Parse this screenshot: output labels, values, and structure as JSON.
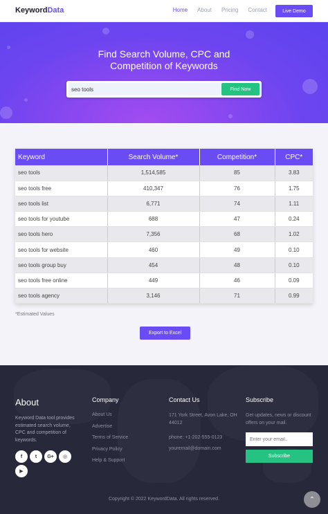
{
  "nav": {
    "logo_main": "Keyword",
    "logo_accent": "Data",
    "links": [
      "Home",
      "About",
      "Pricing",
      "Contact"
    ],
    "demo_label": "Live Demo"
  },
  "hero": {
    "title_line1": "Find Search Volume, CPC and",
    "title_line2": "Competition of Keywords",
    "search_value": "seo tools",
    "find_label": "Find Now"
  },
  "table": {
    "headers": [
      "Keyword",
      "Search Volume*",
      "Competition*",
      "CPC*"
    ],
    "rows": [
      [
        "seo tools",
        "1,514,585",
        "85",
        "3.83"
      ],
      [
        "seo tools free",
        "410,347",
        "76",
        "1.75"
      ],
      [
        "seo tools list",
        "6,771",
        "74",
        "1.11"
      ],
      [
        "seo tools for youtube",
        "688",
        "47",
        "0.24"
      ],
      [
        "seo tools hero",
        "7,356",
        "68",
        "1.02"
      ],
      [
        "seo tools for website",
        "460",
        "49",
        "0.10"
      ],
      [
        "seo tools group buy",
        "454",
        "48",
        "0.10"
      ],
      [
        "seo tools free online",
        "449",
        "46",
        "0.09"
      ],
      [
        "seo tools agency",
        "3,146",
        "71",
        "0.99"
      ]
    ],
    "note": "*Estimated Values",
    "export_label": "Export to Excel"
  },
  "footer": {
    "about_title": "About",
    "about_text": "Keyword Data tool provides estimated search volume, CPC and competition of keywords.",
    "social_icons": [
      "facebook-icon",
      "twitter-icon",
      "google-plus-icon",
      "instagram-icon",
      "youtube-icon"
    ],
    "social_glyphs": [
      "f",
      "t",
      "G+",
      "◎",
      "▶"
    ],
    "company_title": "Company",
    "company_links": [
      "About Us",
      "Advertise",
      "Terms of Service",
      "Privacy Policy",
      "Help & Support"
    ],
    "contact_title": "Contact Us",
    "contact_address": "171 York Street, Avon Lake, OH 44012",
    "contact_phone": "phone: +1-202-555-0123",
    "contact_email": "youremail@domain.com",
    "subscribe_title": "Subscribe",
    "subscribe_text": "Get updates, news or discount offers on your mail.",
    "subscribe_placeholder": "Enter your email..",
    "subscribe_label": "Subscribe",
    "copyright": "Copyright © 2022 KeywordData. All rights reserved."
  },
  "colors": {
    "accent": "#6a4cf5",
    "green": "#26c281",
    "footer_bg": "#272839"
  }
}
